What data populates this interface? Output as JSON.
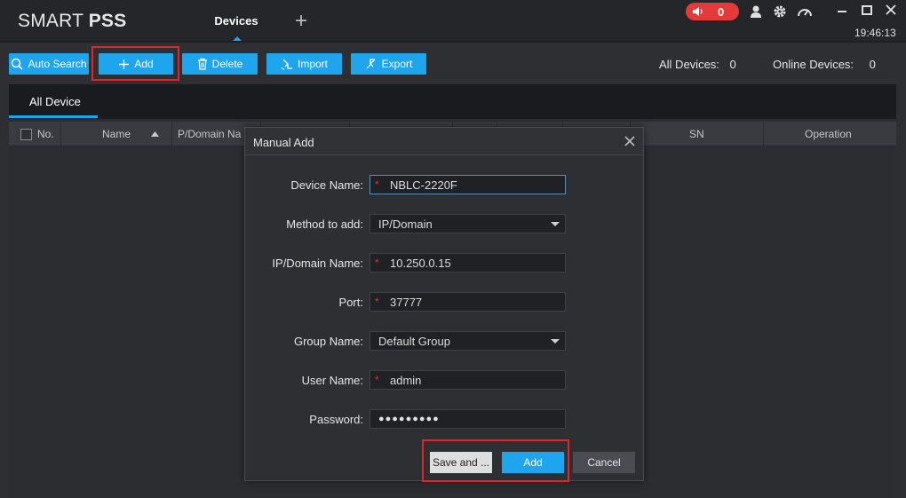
{
  "app": {
    "logo_part1": "SMART ",
    "logo_part2": "PSS",
    "active_tab": "Devices",
    "add_tab_symbol": "+",
    "alarm_count": "0",
    "clock": "19:46:13",
    "accent_color": "#1ea5ee",
    "alarm_color": "#e43a3a",
    "highlight_color": "#e2242d"
  },
  "toolbar": {
    "auto_search": "Auto Search",
    "add": "Add",
    "delete": "Delete",
    "import": "Import",
    "export": "Export",
    "all_devices_label": "All Devices:",
    "all_devices_count": "0",
    "online_devices_label": "Online Devices:",
    "online_devices_count": "0"
  },
  "device_list": {
    "tab": "All Device",
    "columns": [
      "No.",
      "Name",
      "P/Domain Na",
      "SN",
      "Operation"
    ]
  },
  "dialog": {
    "title": "Manual Add",
    "fields": [
      {
        "label": "Device Name:",
        "value": "NBLC-2220F",
        "required": true,
        "type": "text"
      },
      {
        "label": "Method to add:",
        "value": "IP/Domain",
        "required": false,
        "type": "select"
      },
      {
        "label": "IP/Domain Name:",
        "value": "10.250.0.15",
        "required": true,
        "type": "text"
      },
      {
        "label": "Port:",
        "value": "37777",
        "required": true,
        "type": "text"
      },
      {
        "label": "Group Name:",
        "value": "Default Group",
        "required": false,
        "type": "select"
      },
      {
        "label": "User Name:",
        "value": "admin",
        "required": true,
        "type": "text"
      },
      {
        "label": "Password:",
        "value": "●●●●●●●●●",
        "required": false,
        "type": "password"
      }
    ],
    "required_mark": "*",
    "buttons": {
      "save_and": "Save and ...",
      "add": "Add",
      "cancel": "Cancel"
    }
  },
  "icons": [
    "speaker-icon",
    "user-icon",
    "gear-icon",
    "gauge-icon",
    "minimize-icon",
    "maximize-icon",
    "close-icon",
    "search-icon",
    "plus-icon",
    "trash-icon",
    "import-icon",
    "export-icon",
    "sort-up-icon",
    "dropdown-caret-icon"
  ]
}
